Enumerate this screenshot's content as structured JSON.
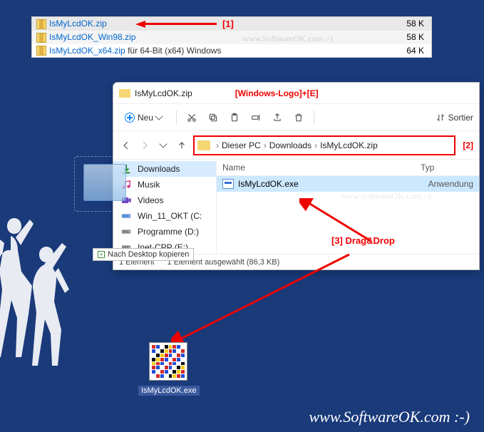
{
  "downloads": {
    "items": [
      {
        "name": "IsMyLcdOK.zip",
        "extra": "",
        "size": "58 K"
      },
      {
        "name": "IsMyLcdOK_Win98.zip",
        "extra": "",
        "size": "58 K"
      },
      {
        "name": "IsMyLcdOK_x64.zip",
        "extra": "für 64-Bit (x64) Windows",
        "size": "64 K"
      }
    ]
  },
  "annot": {
    "a1": "[1]",
    "a2": "[2]",
    "a3": "[3]    Drag&Drop",
    "title_hotkey": "[Windows-Logo]+[E]"
  },
  "watermark": "www.SoftwareOK.com :-)",
  "explorer": {
    "title": "IsMyLcdOK.zip",
    "new_label": "Neu",
    "sort_label": "Sortier",
    "breadcrumb": {
      "pc": "Dieser PC",
      "dl": "Downloads",
      "zip": "IsMyLcdOK.zip"
    },
    "sidebar": [
      {
        "icon": "download",
        "label": "Downloads",
        "selected": true
      },
      {
        "icon": "music",
        "label": "Musik"
      },
      {
        "icon": "video",
        "label": "Videos"
      },
      {
        "icon": "drive",
        "label": "Win_11_OKT (C:"
      },
      {
        "icon": "drive",
        "label": "Programme (D:)"
      },
      {
        "icon": "drive",
        "label": "Inet-CPP (E:)"
      }
    ],
    "columns": {
      "name": "Name",
      "type": "Typ"
    },
    "files": [
      {
        "name": "IsMyLcdOK.exe",
        "type": "Anwendung"
      }
    ],
    "status": {
      "count": "1 Element",
      "selected": "1 Element ausgewählt (86,3 KB)"
    }
  },
  "drag_tip": "Nach Desktop kopieren",
  "desktop_icon": {
    "label": "IsMyLcdOK.exe"
  }
}
